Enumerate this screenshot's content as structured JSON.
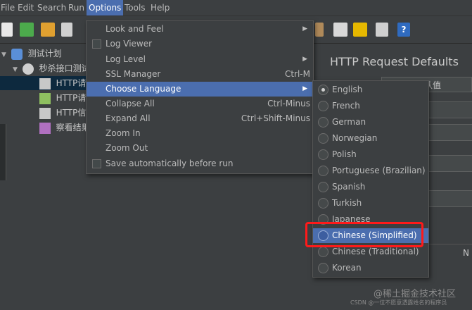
{
  "menubar": {
    "items": [
      "File",
      "Edit",
      "Search",
      "Run",
      "Options",
      "Tools",
      "Help"
    ],
    "active": "Options"
  },
  "tree": {
    "items": [
      {
        "label": "测试计划"
      },
      {
        "label": "秒杀接口测试"
      },
      {
        "label": "HTTP请求"
      },
      {
        "label": "HTTP请求"
      },
      {
        "label": "HTTP信息"
      },
      {
        "label": "察看结果"
      }
    ]
  },
  "right_panel": {
    "title": "HTTP Request Defaults",
    "field_text": "认值",
    "clipped_label": "N"
  },
  "options_menu": {
    "items": [
      {
        "label": "Look and Feel",
        "accel": "",
        "submenu": true,
        "checkbox": false
      },
      {
        "label": "Log Viewer",
        "accel": "",
        "submenu": false,
        "checkbox": true
      },
      {
        "label": "Log Level",
        "accel": "",
        "submenu": true,
        "checkbox": false
      },
      {
        "label": "SSL Manager",
        "accel": "Ctrl-M",
        "submenu": false,
        "checkbox": false
      },
      {
        "label": "Choose Language",
        "accel": "",
        "submenu": true,
        "checkbox": false
      },
      {
        "label": "Collapse All",
        "accel": "Ctrl-Minus",
        "submenu": false,
        "checkbox": false
      },
      {
        "label": "Expand All",
        "accel": "Ctrl+Shift-Minus",
        "submenu": false,
        "checkbox": false
      },
      {
        "label": "Zoom In",
        "accel": "",
        "submenu": false,
        "checkbox": false
      },
      {
        "label": "Zoom Out",
        "accel": "",
        "submenu": false,
        "checkbox": false
      },
      {
        "label": "Save automatically before run",
        "accel": "",
        "submenu": false,
        "checkbox": true
      }
    ],
    "highlighted": "Choose Language"
  },
  "language_menu": {
    "items": [
      "English",
      "French",
      "German",
      "Norwegian",
      "Polish",
      "Portuguese (Brazilian)",
      "Spanish",
      "Turkish",
      "Japanese",
      "Chinese (Simplified)",
      "Chinese (Traditional)",
      "Korean"
    ],
    "selected": "English",
    "highlighted": "Chinese (Simplified)"
  },
  "watermark": {
    "line1": "@稀土掘金技术社区",
    "line2": "CSDN @一位不愿意透露姓名的程序员"
  },
  "colors": {
    "background": "#3c3f41",
    "highlight": "#4b6eaf",
    "annotation_box": "#ff1a1a"
  }
}
